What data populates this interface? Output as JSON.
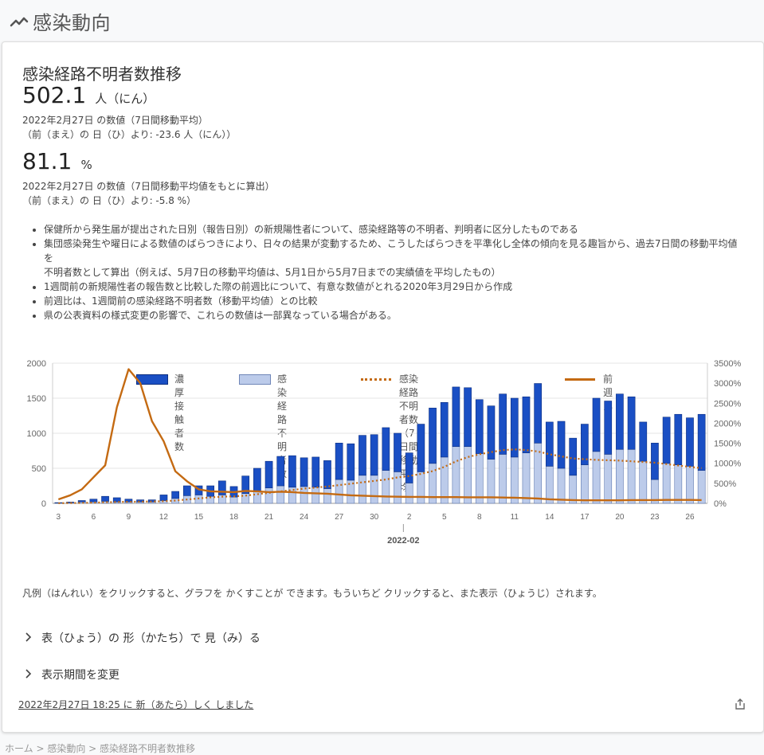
{
  "header": {
    "title": "感染動向",
    "icon": "trend-line-icon"
  },
  "card": {
    "title": "感染経路不明者数推移",
    "main_value": "502.1",
    "main_unit": "人（にん）",
    "main_date": "2022年2月27日 の数値（7日間移動平均）",
    "main_diff": "（前（まえ）の 日（ひ）より: -23.6 人（にん））",
    "ratio_value": "81.1",
    "ratio_unit": "%",
    "ratio_date": "2022年2月27日 の数値（7日間移動平均値をもとに算出）",
    "ratio_diff": "（前（まえ）の 日（ひ）より: -5.8 %）",
    "notes": [
      "保健所から発生届が提出された日別（報告日別）の新規陽性者について、感染経路等の不明者、判明者に区分したものである",
      "集団感染発生や曜日による数値のばらつきにより、日々の結果が変動するため、こうしたばらつきを平準化し全体の傾向を見る趣旨から、過去7日間の移動平均値を",
      "不明者数として算出（例えば、5月7日の移動平均値は、5月1日から5月7日までの実績値を平均したもの）",
      "1週間前の新規陽性者の報告数と比較した際の前週比について、有意な数値がとれる2020年3月29日から作成",
      "前週比は、1週間前の感染経路不明者数（移動平均値）との比較",
      "県の公表資料の様式変更の影響で、これらの数値は一部異なっている場合がある。"
    ],
    "legend_hint": "凡例（はんれい）をクリックすると、グラフを かくすことが できます。もういちど クリックすると、また表示（ひょうじ）されます。",
    "expand_table": "表（ひょう）の 形（かたち）で 見（み）る",
    "expand_period": "表示期間を変更",
    "updated": "2022年2月27日 18:25 に 新（あたら）しく しました",
    "share_icon": "share-icon"
  },
  "breadcrumb": "ホーム  >  感染動向  >  感染経路不明者数推移",
  "chart_data": {
    "type": "bar",
    "stacked": true,
    "colors": {
      "known": "#1a4fc4",
      "unknown": "#bccbea",
      "avg": "#c46a12",
      "ratio": "#c46a12"
    },
    "x": [
      "1/3",
      "1/4",
      "1/5",
      "1/6",
      "1/7",
      "1/8",
      "1/9",
      "1/10",
      "1/11",
      "1/12",
      "1/13",
      "1/14",
      "1/15",
      "1/16",
      "1/17",
      "1/18",
      "1/19",
      "1/20",
      "1/21",
      "1/22",
      "1/23",
      "1/24",
      "1/25",
      "1/26",
      "1/27",
      "1/28",
      "1/29",
      "1/30",
      "1/31",
      "2/1",
      "2/2",
      "2/3",
      "2/4",
      "2/5",
      "2/6",
      "2/7",
      "2/8",
      "2/9",
      "2/10",
      "2/11",
      "2/12",
      "2/13",
      "2/14",
      "2/15",
      "2/16",
      "2/17",
      "2/18",
      "2/19",
      "2/20",
      "2/21",
      "2/22",
      "2/23",
      "2/24",
      "2/25",
      "2/26",
      "2/27"
    ],
    "x_tick_labels": [
      "3",
      "6",
      "9",
      "12",
      "15",
      "18",
      "21",
      "24",
      "27",
      "30",
      "2",
      "5",
      "8",
      "11",
      "14",
      "17",
      "20",
      "23",
      "26"
    ],
    "x_tick_index": [
      0,
      3,
      6,
      9,
      12,
      15,
      18,
      21,
      24,
      27,
      30,
      33,
      36,
      39,
      42,
      45,
      48,
      51,
      54
    ],
    "xlabel": "2022-02",
    "month_tick_index": 30,
    "series": [
      {
        "name": "濃厚接触者数",
        "axis": "left",
        "values": [
          5,
          8,
          20,
          40,
          70,
          60,
          40,
          30,
          30,
          80,
          100,
          140,
          130,
          150,
          200,
          150,
          250,
          330,
          380,
          420,
          450,
          410,
          430,
          400,
          520,
          520,
          570,
          580,
          610,
          550,
          430,
          680,
          790,
          780,
          850,
          840,
          770,
          760,
          860,
          840,
          800,
          850,
          630,
          670,
          530,
          580,
          760,
          760,
          790,
          750,
          560,
          520,
          660,
          720,
          690,
          800
        ]
      },
      {
        "name": "感染経路不明者数",
        "axis": "left",
        "values": [
          5,
          10,
          20,
          20,
          30,
          20,
          20,
          20,
          20,
          40,
          70,
          110,
          120,
          100,
          120,
          90,
          140,
          170,
          220,
          250,
          230,
          240,
          230,
          210,
          340,
          330,
          400,
          400,
          470,
          450,
          290,
          450,
          570,
          660,
          810,
          810,
          710,
          630,
          700,
          660,
          720,
          860,
          530,
          500,
          400,
          550,
          740,
          700,
          770,
          770,
          600,
          340,
          570,
          550,
          530,
          470
        ]
      },
      {
        "name": "感染経路不明者数（7日間移動平均）",
        "axis": "left",
        "style": "dotted",
        "values": [
          2,
          4,
          6,
          10,
          15,
          20,
          22,
          24,
          26,
          30,
          40,
          55,
          70,
          85,
          95,
          100,
          110,
          130,
          150,
          170,
          190,
          210,
          225,
          240,
          260,
          280,
          300,
          320,
          340,
          370,
          390,
          420,
          460,
          520,
          600,
          660,
          700,
          730,
          760,
          770,
          760,
          740,
          700,
          670,
          640,
          630,
          620,
          615,
          610,
          600,
          590,
          580,
          560,
          540,
          520,
          502
        ]
      },
      {
        "name": "前週比",
        "axis": "right",
        "values": [
          100,
          200,
          350,
          650,
          950,
          2400,
          3350,
          3000,
          2050,
          1550,
          800,
          550,
          350,
          300,
          290,
          280,
          310,
          300,
          280,
          290,
          280,
          260,
          250,
          240,
          220,
          200,
          190,
          180,
          170,
          165,
          160,
          160,
          155,
          155,
          155,
          150,
          150,
          150,
          145,
          140,
          130,
          120,
          100,
          90,
          80,
          75,
          75,
          75,
          75,
          80,
          80,
          80,
          85,
          85,
          85,
          81
        ]
      }
    ],
    "ylim_left": [
      0,
      2000
    ],
    "yticks_left": [
      0,
      500,
      1000,
      1500,
      2000
    ],
    "ylim_right": [
      0,
      3500
    ],
    "yticks_right": [
      "0%",
      "500%",
      "1000%",
      "1500%",
      "2000%",
      "2500%",
      "3000%",
      "3500%"
    ],
    "legend_position": "top"
  }
}
